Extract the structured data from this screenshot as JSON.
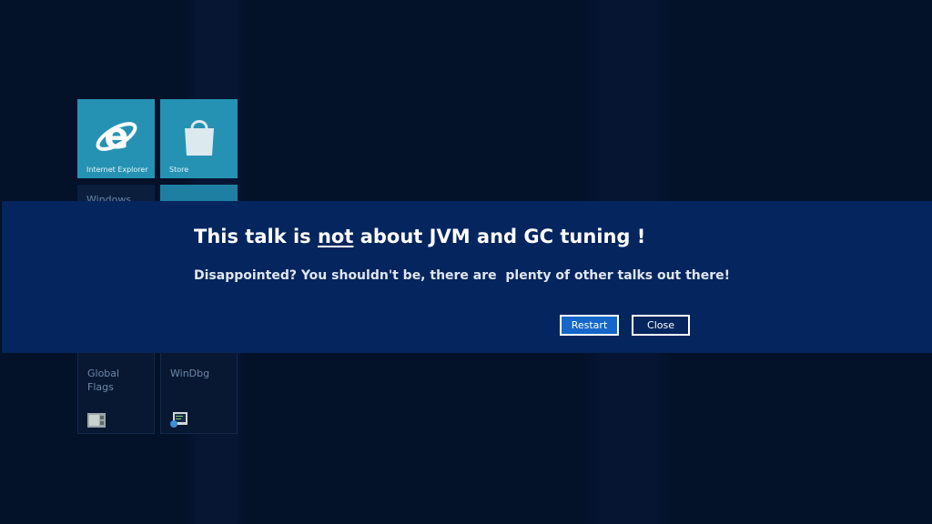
{
  "tiles": {
    "internet_explorer": "Internet Explorer",
    "store": "Store",
    "windows": "Windows",
    "global_flags": "Global\nFlags",
    "windbg": "WinDbg"
  },
  "dialog": {
    "title_before": "This talk is ",
    "title_emphasis": "not",
    "title_after": " about JVM and GC tuning !",
    "message": "Disappointed? You shouldn't be, there are  plenty of other talks out there!",
    "restart_label": "Restart",
    "close_label": "Close"
  },
  "colors": {
    "tile_accent": "#2592b3",
    "banner": "#05255e",
    "primary_button": "#1466c8"
  },
  "icons": {
    "ie": "internet-explorer-icon",
    "store": "store-bag-icon",
    "global_flags": "global-flags-app-icon",
    "windbg": "windbg-app-icon"
  }
}
